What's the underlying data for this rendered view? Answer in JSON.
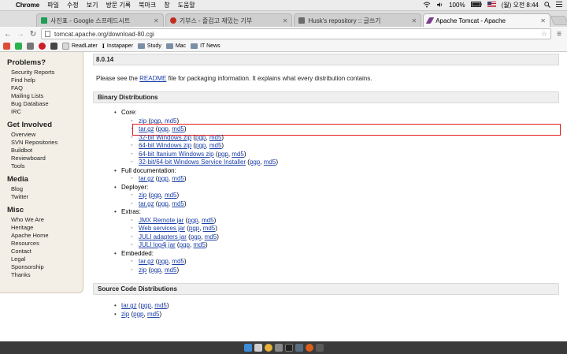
{
  "menubar": {
    "app": "Chrome",
    "items": [
      "파일",
      "수정",
      "보기",
      "방문 기록",
      "북마크",
      "창",
      "도움말"
    ],
    "battery": "100%",
    "clock": "(월) 오전 8:44"
  },
  "tabs": [
    {
      "label": "사진표 - Google 스프레드시트",
      "active": false,
      "color": "#1e9d55"
    },
    {
      "label": "기부스 - 즐겁고 재밌는 기부",
      "active": false,
      "color": "#c22d20"
    },
    {
      "label": "Husk's repository :: 글쓰기",
      "active": false,
      "color": "#6a6a6a"
    },
    {
      "label": "Apache Tomcat - Apache",
      "active": true,
      "color": "#7a3d8c"
    }
  ],
  "toolbar": {
    "url": "tomcat.apache.org/download-80.cgi"
  },
  "bookmarks": [
    {
      "label": "ReadLater",
      "type": "link"
    },
    {
      "label": "Instapaper",
      "type": "link"
    },
    {
      "label": "Study",
      "type": "folder"
    },
    {
      "label": "Mac",
      "type": "folder"
    },
    {
      "label": "IT News",
      "type": "folder"
    }
  ],
  "sidebar": {
    "sections": [
      {
        "title": "Problems?",
        "links": [
          "Security Reports",
          "Find help",
          "FAQ",
          "Mailing Lists",
          "Bug Database",
          "IRC"
        ]
      },
      {
        "title": "Get Involved",
        "links": [
          "Overview",
          "SVN Repositories",
          "Buildbot",
          "Reviewboard",
          "Tools"
        ]
      },
      {
        "title": "Media",
        "links": [
          "Blog",
          "Twitter"
        ]
      },
      {
        "title": "Misc",
        "links": [
          "Who We Are",
          "Heritage",
          "Apache Home",
          "Resources",
          "Contact",
          "Legal",
          "Sponsorship",
          "Thanks"
        ]
      }
    ]
  },
  "main": {
    "version": "8.0.14",
    "intro_before": "Please see the ",
    "intro_link": "README",
    "intro_after": " file for packaging information. It explains what every distribution contains.",
    "binary_title": "Binary Distributions",
    "pgp": "pgp",
    "md5": "md5",
    "groups": [
      {
        "label": "Core:",
        "items": [
          "zip",
          "tar.gz",
          "32-bit Windows zip",
          "64-bit Windows zip",
          "64-bit Itanium Windows zip",
          "32-bit/64-bit Windows Service Installer"
        ]
      },
      {
        "label": "Full documentation:",
        "items": [
          "tar.gz"
        ]
      },
      {
        "label": "Deployer:",
        "items": [
          "zip",
          "tar.gz"
        ]
      },
      {
        "label": "Extras:",
        "items": [
          "JMX Remote jar",
          "Web services jar",
          "JULI adapters jar",
          "JULI log4j jar"
        ]
      },
      {
        "label": "Embedded:",
        "items": [
          "tar.gz",
          "zip"
        ]
      }
    ],
    "source_title": "Source Code Distributions",
    "source_items": [
      "tar.gz",
      "zip"
    ]
  }
}
